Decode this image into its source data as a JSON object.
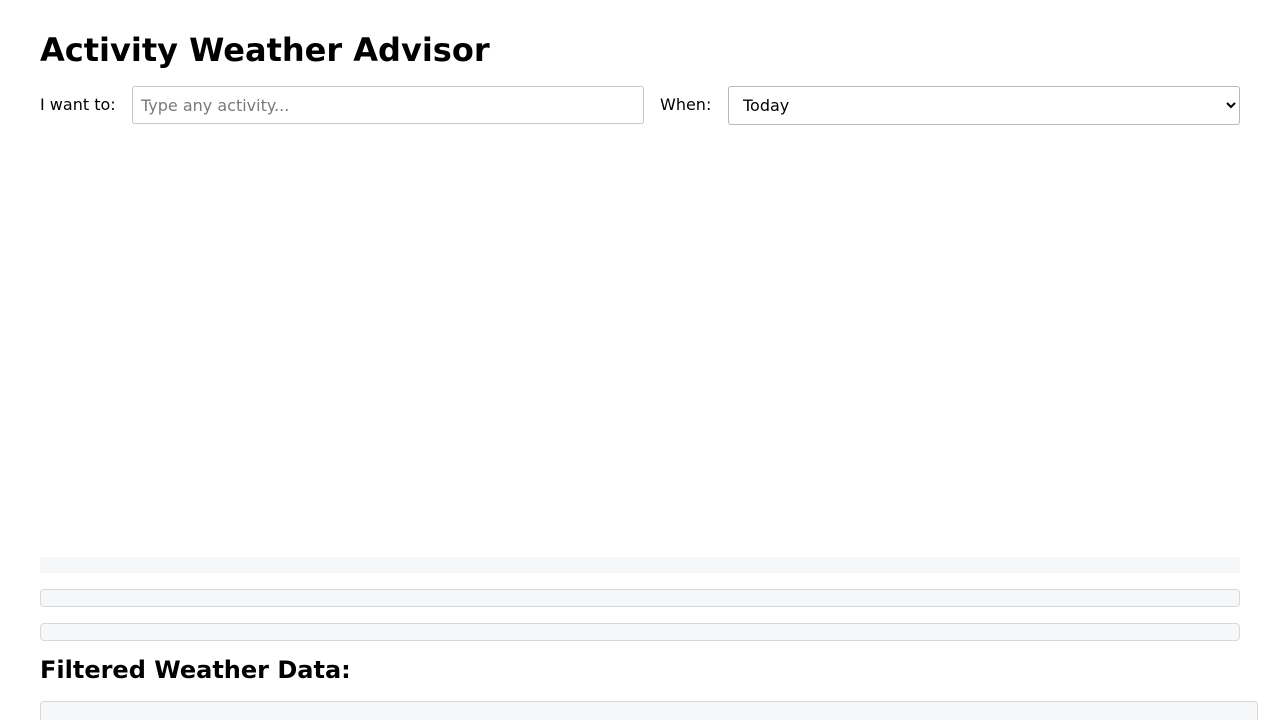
{
  "app": {
    "title": "Activity Weather Advisor"
  },
  "form": {
    "activity_label": "I want to:",
    "activity_value": "",
    "activity_placeholder": "Type any activity...",
    "when_label": "When:",
    "when_selected": "Today"
  },
  "results": {
    "filtered_heading": "Filtered Weather Data:"
  }
}
